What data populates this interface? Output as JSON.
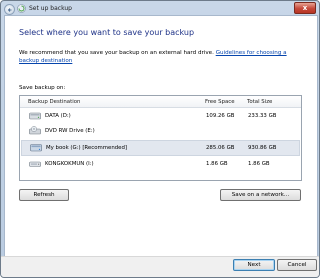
{
  "window": {
    "title": "Set up backup",
    "close_label": "x"
  },
  "content": {
    "heading": "Select where you want to save your backup",
    "description": "We recommend that you save your backup on an external hard drive.",
    "guidelines_link": "Guidelines for choosing a backup destination",
    "save_on_label": "Save backup on:"
  },
  "table": {
    "columns": [
      "Backup Destination",
      "Free Space",
      "Total Size"
    ],
    "rows": [
      {
        "name": "DATA (D:)",
        "free": "109.26 GB",
        "total": "233.33 GB",
        "icon": "hard-drive-icon"
      },
      {
        "name": "DVD RW Drive (E:)",
        "free": "",
        "total": "",
        "icon": "dvd-drive-icon"
      },
      {
        "name": "My book (G:) [Recommended]",
        "free": "285.06 GB",
        "total": "930.86 GB",
        "icon": "external-drive-icon",
        "selected": true
      },
      {
        "name": "KONGKOKMUN (I:)",
        "free": "1.86 GB",
        "total": "1.86 GB",
        "icon": "removable-drive-icon"
      }
    ]
  },
  "buttons": {
    "refresh": "Refresh",
    "save_network": "Save on a network...",
    "next": "Next",
    "cancel": "Cancel"
  }
}
